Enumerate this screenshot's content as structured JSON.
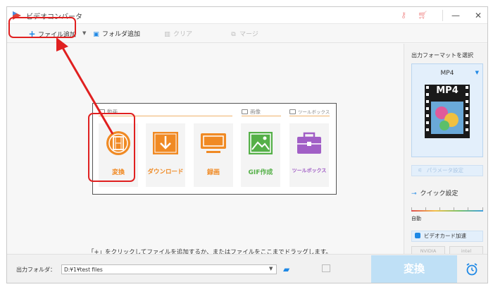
{
  "window": {
    "title": "ビデオコンバータ",
    "controls": {
      "minimize": "—",
      "maximize": "☐",
      "close": "✕"
    }
  },
  "toolbar": {
    "add_file": "ファイル追加",
    "add_folder": "フォルダ追加",
    "clear": "クリア",
    "merge": "マージ"
  },
  "feature_panel": {
    "sections": {
      "video": "動画",
      "image": "画像",
      "toolbox": "ツールボックス"
    },
    "cards": [
      {
        "label": "変換",
        "icon": "film-reel-icon"
      },
      {
        "label": "ダウンロード",
        "icon": "download-icon"
      },
      {
        "label": "録画",
        "icon": "screen-record-icon"
      },
      {
        "label": "GIF作成",
        "icon": "image-icon"
      },
      {
        "label": "ツールボックス",
        "icon": "toolbox-icon"
      }
    ]
  },
  "hint": "「+」をクリックしてファイルを追加するか、またはファイルをここまでドラッグします。",
  "right_panel": {
    "title": "出力フォーマットを選択",
    "format": "MP4",
    "format_badge": "MP4",
    "param_settings": "パラメータ設定",
    "quick_settings": "クイック設定",
    "auto": "自動",
    "gpu_accel": "ビデオカード加速",
    "vendors": [
      "NVIDIA",
      "intel"
    ]
  },
  "bottom": {
    "output_folder_label": "出力フォルダ：",
    "output_folder_value": "D:¥1¥test files",
    "convert": "変換"
  },
  "colors": {
    "accent_blue": "#1e88e5",
    "orange": "#f08a24",
    "green": "#55b048",
    "purple": "#a15fc6",
    "annotation_red": "#e02020",
    "convert_button": "#bfe0f6"
  }
}
